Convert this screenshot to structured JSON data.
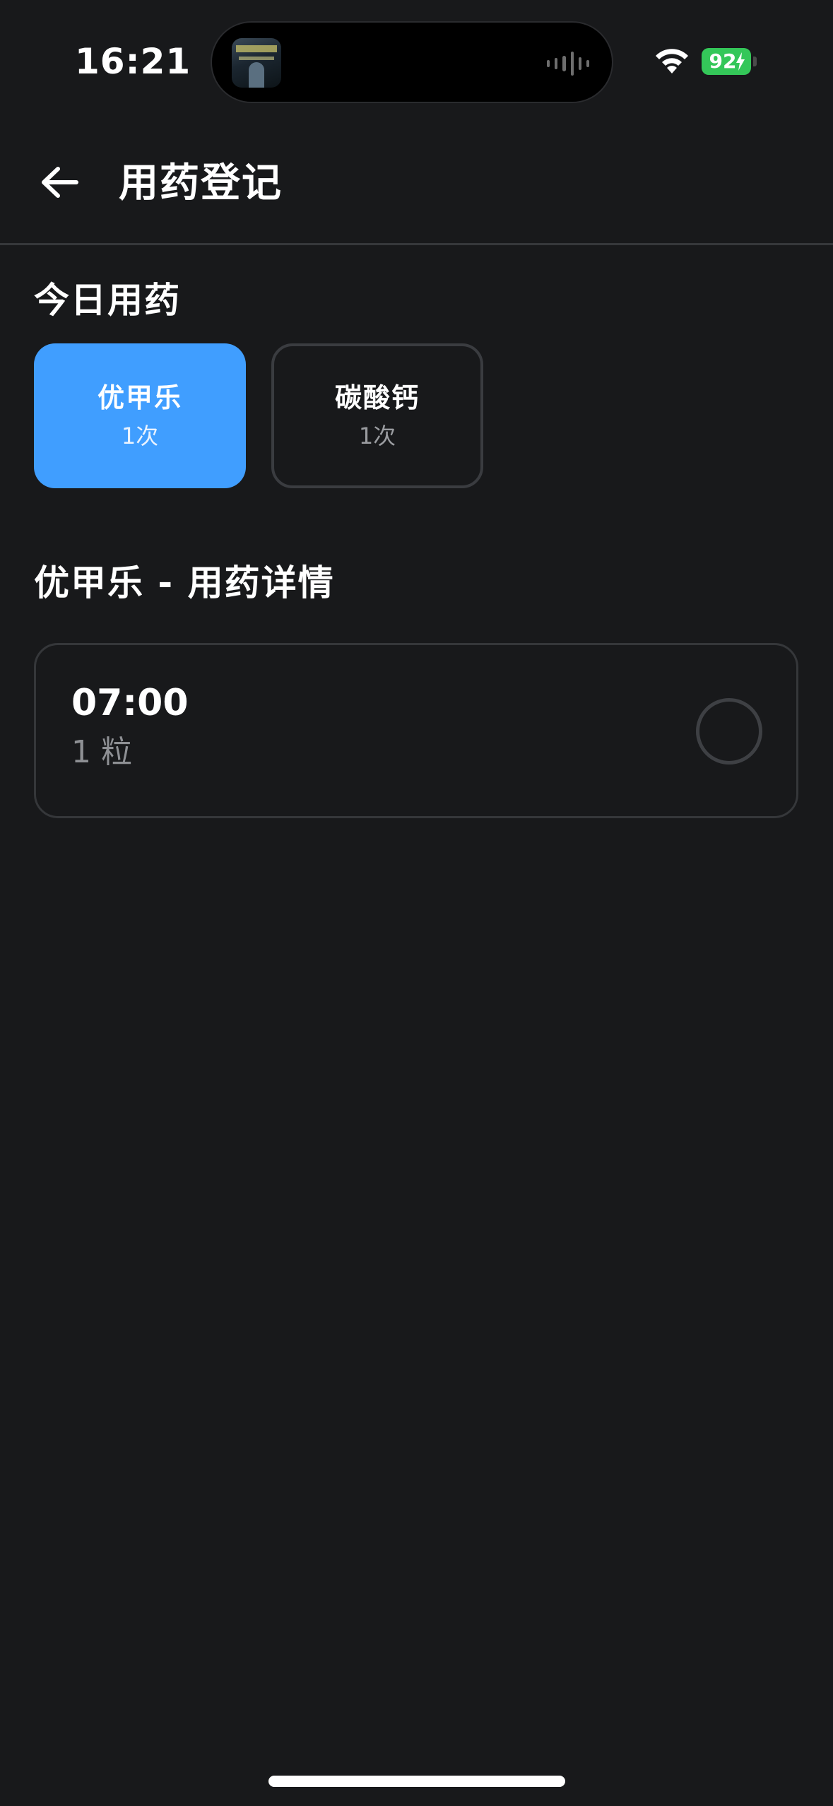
{
  "status_bar": {
    "time": "16:21",
    "battery_level": "92",
    "battery_charging": true,
    "battery_color": "#34c759",
    "icons": [
      "now-playing-album-art",
      "audio-waveform-icon",
      "wifi-icon",
      "battery-icon",
      "charging-bolt-icon"
    ]
  },
  "header": {
    "back_icon": "arrow-left-icon",
    "title": "用药登记"
  },
  "today": {
    "title": "今日用药",
    "medications": [
      {
        "name": "优甲乐",
        "count": "1次",
        "selected": true
      },
      {
        "name": "碳酸钙",
        "count": "1次",
        "selected": false
      }
    ]
  },
  "detail": {
    "title": "优甲乐 - 用药详情",
    "doses": [
      {
        "time": "07:00",
        "amount": "1 粒",
        "taken": false
      }
    ]
  },
  "colors": {
    "background": "#18191b",
    "accent": "#409eff",
    "border": "#3a3c40",
    "muted_text": "#8e9094"
  }
}
